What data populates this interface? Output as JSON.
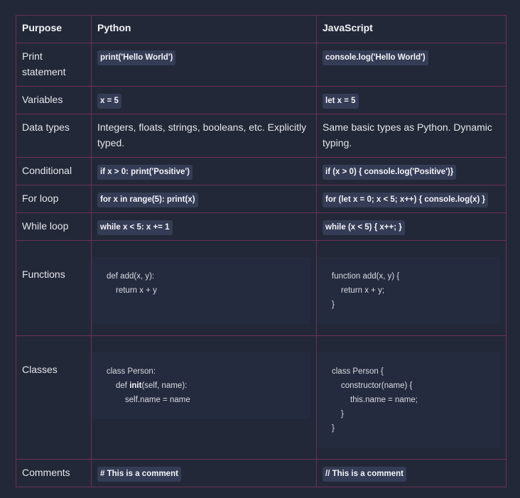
{
  "headers": {
    "purpose": "Purpose",
    "python": "Python",
    "javascript": "JavaScript"
  },
  "rows": [
    {
      "purpose": "Print statement",
      "python": "print('Hello World')",
      "javascript": "console.log('Hello World')"
    },
    {
      "purpose": "Variables",
      "python": "x = 5",
      "javascript": "let x = 5"
    },
    {
      "purpose": "Data types",
      "python": "Integers, floats, strings, booleans, etc. Explicitly typed.",
      "javascript": "Same basic types as Python. Dynamic typing."
    },
    {
      "purpose": "Conditional",
      "python": "if x > 0: print('Positive')",
      "javascript": "if (x > 0) { console.log('Positive')}"
    },
    {
      "purpose": "For loop",
      "python": "for x in range(5): print(x)",
      "javascript": "for (let x = 0; x < 5; x++) { console.log(x) }"
    },
    {
      "purpose": "While loop",
      "python": "while x < 5: x += 1",
      "javascript": "while (x < 5) { x++; }"
    },
    {
      "purpose": "Functions",
      "python_lines": [
        "def add(x, y):",
        "return x + y"
      ],
      "javascript_lines": [
        "function add(x, y) {",
        "return x + y;",
        "}"
      ]
    },
    {
      "purpose": "Classes",
      "python_lines": [
        "class Person:",
        "def ",
        "init",
        "(self, name):",
        "self.name = name"
      ],
      "javascript_lines": [
        "class Person {",
        "constructor(name) {",
        "this.name = name;",
        "}",
        "}"
      ]
    },
    {
      "purpose": "Comments",
      "python": "# This is a comment",
      "javascript": "// This is a comment"
    }
  ]
}
